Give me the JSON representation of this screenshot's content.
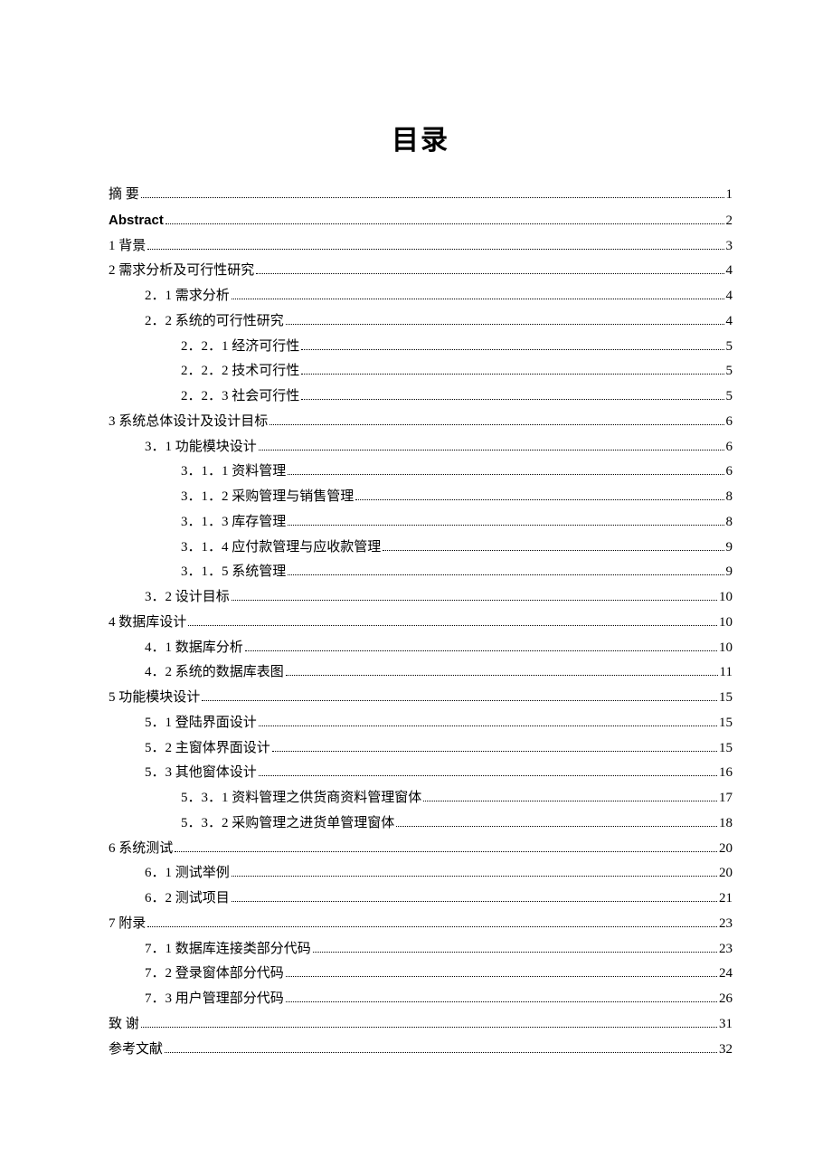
{
  "title": "目录",
  "entries": [
    {
      "level": 0,
      "label": "摘    要",
      "page": "1"
    },
    {
      "level": 0,
      "label": "Abstract",
      "page": "2",
      "bold": true
    },
    {
      "level": 0,
      "label": "1    背景",
      "page": "3"
    },
    {
      "level": 0,
      "label": "2    需求分析及可行性研究",
      "page": "4"
    },
    {
      "level": 1,
      "label": "2．1 需求分析",
      "page": "4"
    },
    {
      "level": 1,
      "label": "2．2 系统的可行性研究",
      "page": "4"
    },
    {
      "level": 2,
      "label": "2．2．1 经济可行性",
      "page": "5"
    },
    {
      "level": 2,
      "label": "2．2．2 技术可行性",
      "page": "5"
    },
    {
      "level": 2,
      "label": "2．2．3 社会可行性",
      "page": "5"
    },
    {
      "level": 0,
      "label": "3 系统总体设计及设计目标",
      "page": "6"
    },
    {
      "level": 1,
      "label": "3．1 功能模块设计",
      "page": "6"
    },
    {
      "level": 2,
      "label": "3．1．1 资料管理",
      "page": "6"
    },
    {
      "level": 2,
      "label": "3．1．2 采购管理与销售管理",
      "page": "8"
    },
    {
      "level": 2,
      "label": "3．1．3 库存管理",
      "page": "8"
    },
    {
      "level": 2,
      "label": "3．1．4 应付款管理与应收款管理",
      "page": "9"
    },
    {
      "level": 2,
      "label": "3．1．5 系统管理",
      "page": "9"
    },
    {
      "level": 1,
      "label": "3．2 设计目标",
      "page": "10"
    },
    {
      "level": 0,
      "label": "4 数据库设计",
      "page": "10"
    },
    {
      "level": 1,
      "label": "4．1 数据库分析",
      "page": "10"
    },
    {
      "level": 1,
      "label": "4．2 系统的数据库表图",
      "page": "11"
    },
    {
      "level": 0,
      "label": "5  功能模块设计",
      "page": "15"
    },
    {
      "level": 1,
      "label": "5．1 登陆界面设计",
      "page": "15"
    },
    {
      "level": 1,
      "label": "5．2 主窗体界面设计",
      "page": "15"
    },
    {
      "level": 1,
      "label": "5．3 其他窗体设计",
      "page": "16"
    },
    {
      "level": 2,
      "label": "5．3．1 资料管理之供货商资料管理窗体",
      "page": "17"
    },
    {
      "level": 2,
      "label": "5．3．2 采购管理之进货单管理窗体",
      "page": "18"
    },
    {
      "level": 0,
      "label": "6 系统测试",
      "page": "20"
    },
    {
      "level": 1,
      "label": "6．1 测试举例",
      "page": "20"
    },
    {
      "level": 1,
      "label": "6．2 测试项目",
      "page": "21"
    },
    {
      "level": 0,
      "label": "7 附录",
      "page": "23"
    },
    {
      "level": 1,
      "label": "7．1 数据库连接类部分代码",
      "page": "23"
    },
    {
      "level": 1,
      "label": "7．2 登录窗体部分代码",
      "page": "24"
    },
    {
      "level": 1,
      "label": "7．3 用户管理部分代码",
      "page": "26"
    },
    {
      "level": 0,
      "label": "致     谢",
      "page": "31"
    },
    {
      "level": 0,
      "label": "参考文献",
      "page": "32"
    }
  ]
}
